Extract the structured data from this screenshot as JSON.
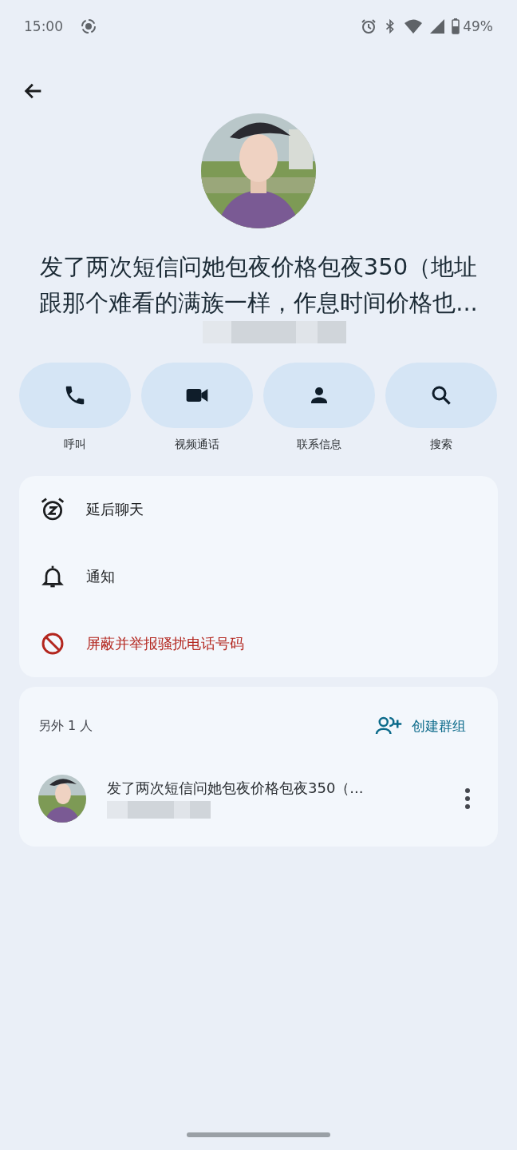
{
  "status_bar": {
    "time": "15:00",
    "battery": "49%"
  },
  "contact": {
    "name": "发了两次短信问她包夜价格包夜350（地址跟那个难看的满族一样，作息时间价格也..."
  },
  "actions": [
    {
      "label": "呼叫",
      "kind": "call"
    },
    {
      "label": "视频通话",
      "kind": "video"
    },
    {
      "label": "联系信息",
      "kind": "contact"
    },
    {
      "label": "搜索",
      "kind": "search"
    }
  ],
  "options": [
    {
      "label": "延后聊天",
      "kind": "snooze"
    },
    {
      "label": "通知",
      "kind": "notifications"
    },
    {
      "label": "屏蔽并举报骚扰电话号码",
      "kind": "block"
    }
  ],
  "others": {
    "heading": "另外 1 人",
    "action": "创建群组",
    "members": [
      {
        "preview": "发了两次短信问她包夜价格包夜350（..."
      }
    ]
  }
}
